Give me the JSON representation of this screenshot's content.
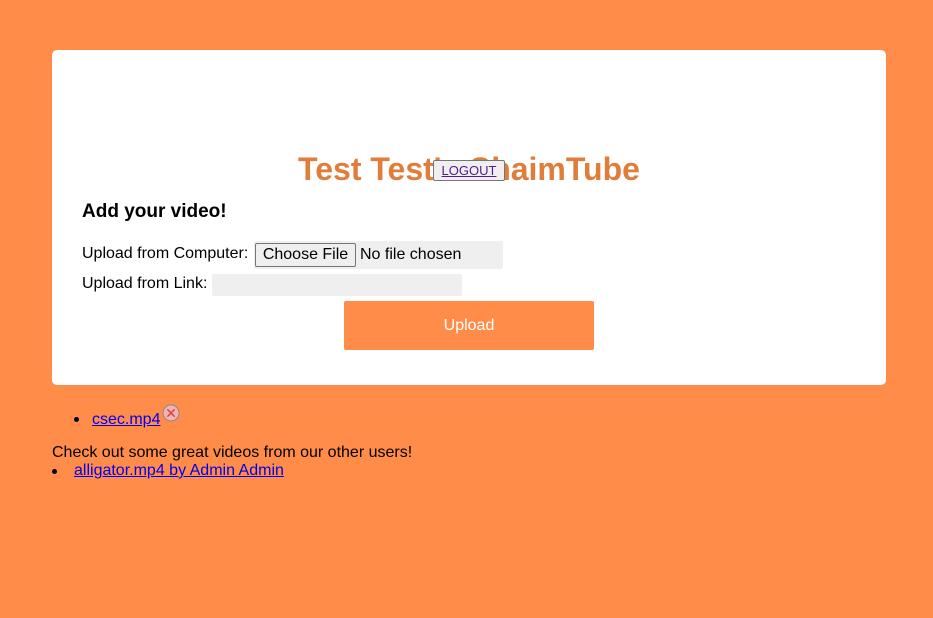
{
  "header": {
    "title": "Test Test's ChaimTube",
    "logout_label": "LOGOUT"
  },
  "upload_form": {
    "heading": "Add your video!",
    "computer_label": "Upload from Computer:",
    "choose_file_label": "Choose File",
    "file_status": "No file chosen",
    "link_label": "Upload from Link:",
    "link_value": "",
    "submit_label": "Upload"
  },
  "my_videos": {
    "items": [
      {
        "title": "csec.mp4",
        "delete_icon": "close-circle-icon"
      }
    ]
  },
  "others": {
    "intro": "Check out some great videos from our other users!",
    "items": [
      {
        "label": "alligator.mp4 by Admin Admin"
      }
    ]
  },
  "colors": {
    "page_background": "#ff8c48",
    "title": "#e07d3a",
    "upload_button": "#ff8c48",
    "link": "#0000ee",
    "visited_link": "#551a8b"
  }
}
